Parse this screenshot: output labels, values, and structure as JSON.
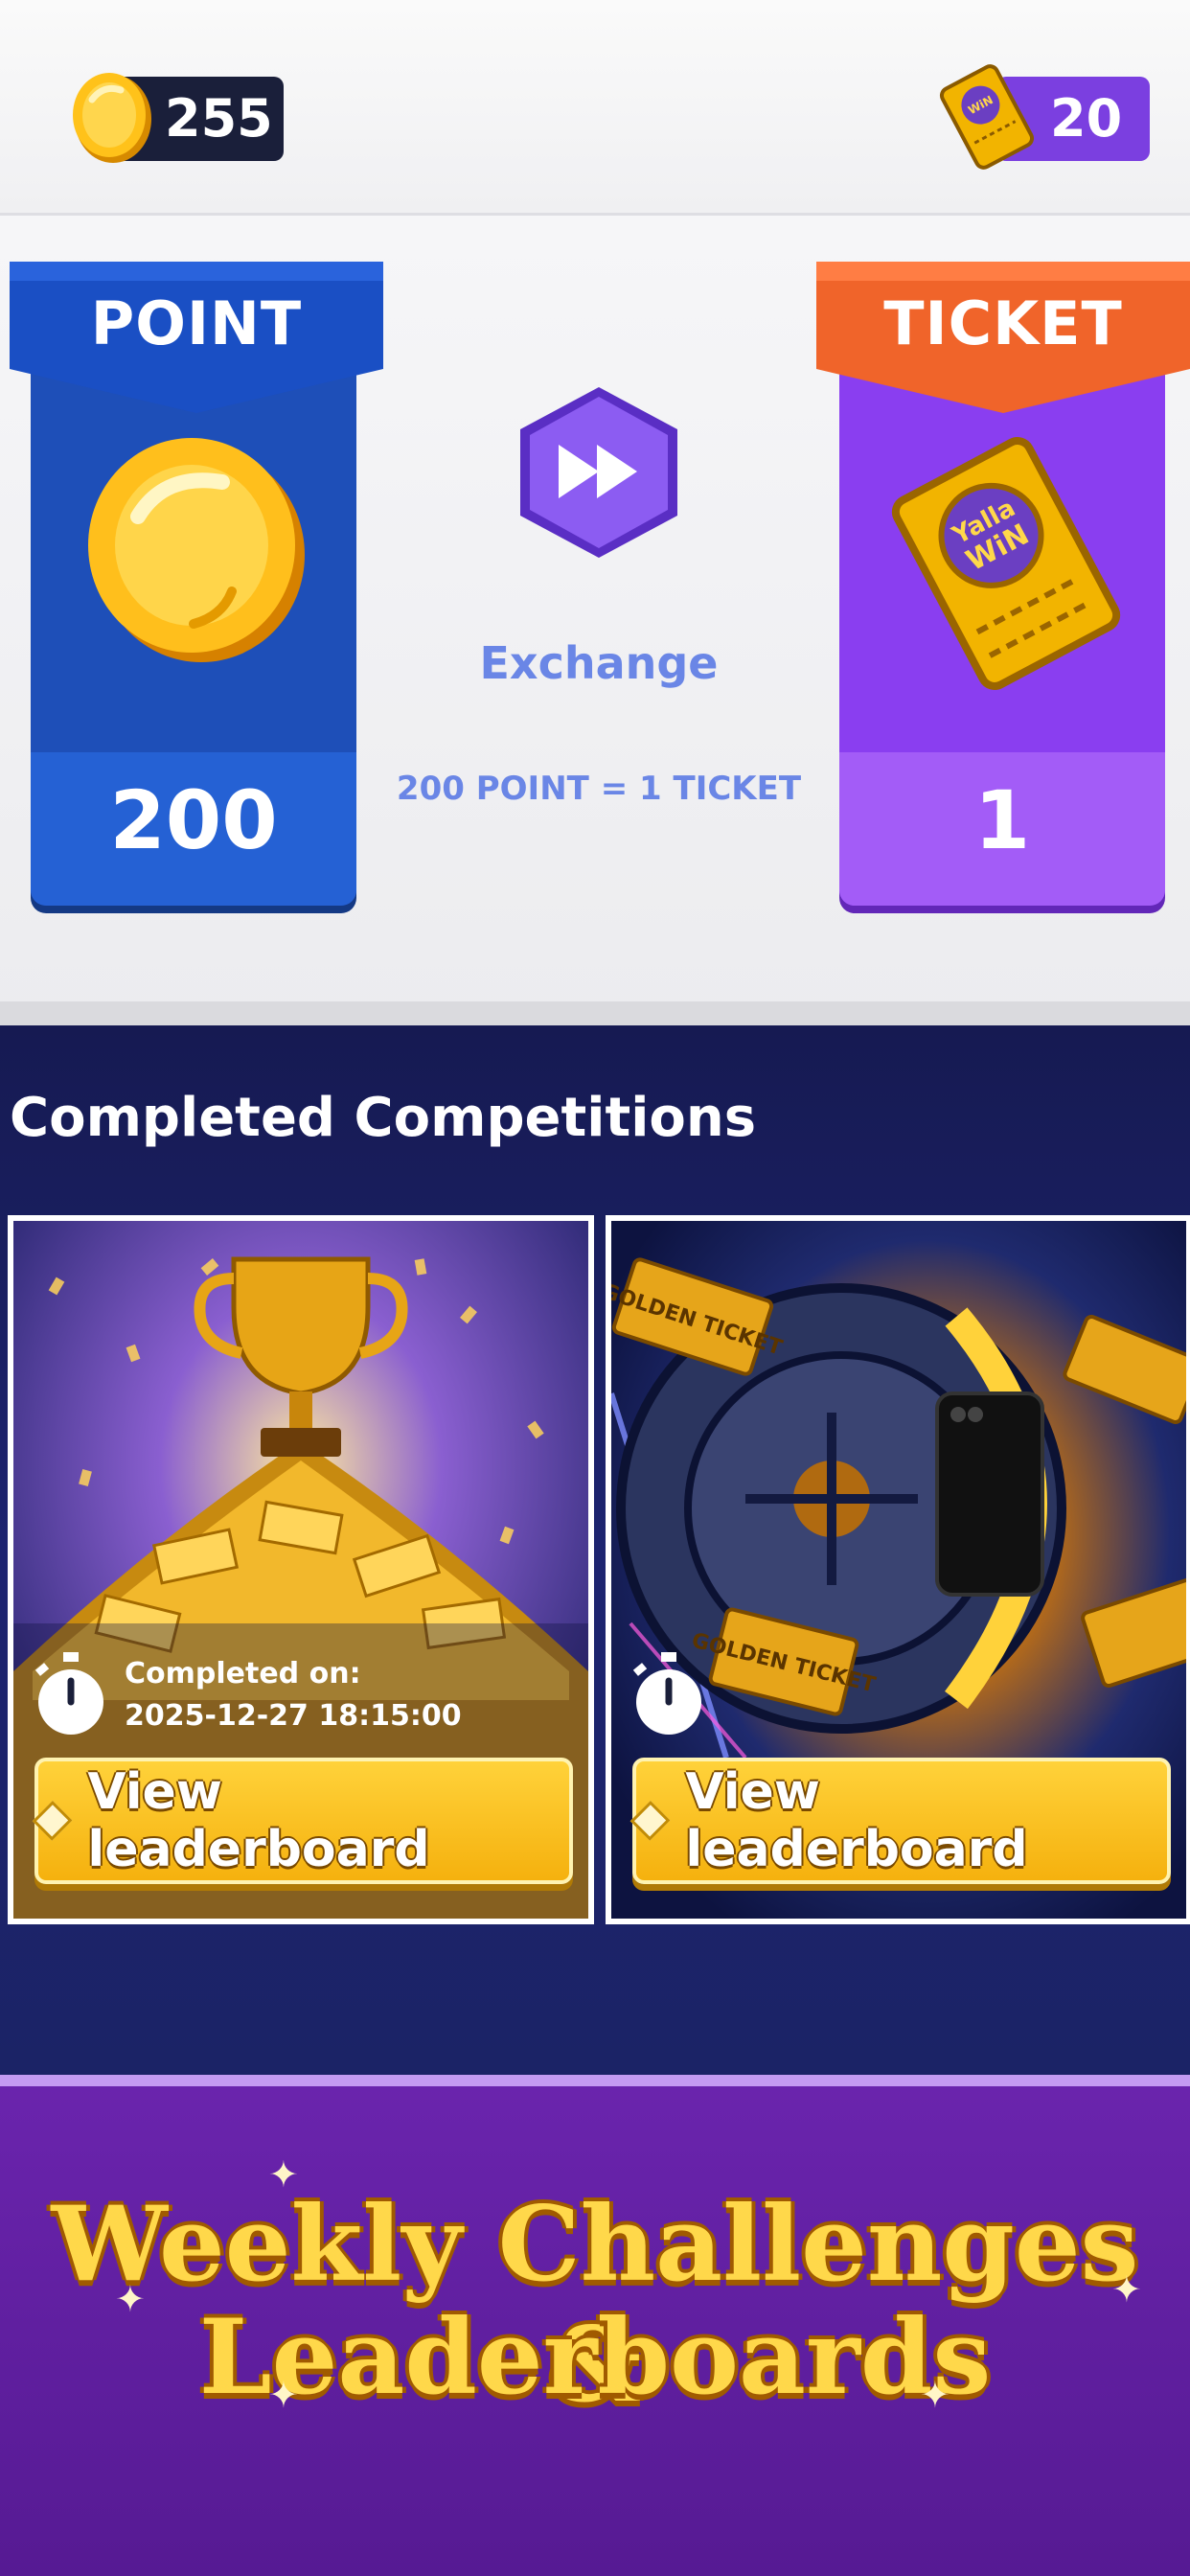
{
  "balance": {
    "points": "255",
    "tickets": "20"
  },
  "exchange": {
    "point_card": {
      "label": "POINT",
      "value": "200"
    },
    "ticket_card": {
      "label": "TICKET",
      "value": "1",
      "logo_text_top": "Yalla",
      "logo_text_bottom": "WiN"
    },
    "button_label": "Exchange",
    "rate_text": "200 POINT = 1 TICKET"
  },
  "competitions": {
    "title": "Completed Competitions",
    "cards": [
      {
        "completed_label": "Completed on:",
        "completed_date": "2025-12-27 18:15:00",
        "button_label": "View leaderboard"
      },
      {
        "art_text_1": "GOLDEN TICKET",
        "art_text_2": "GOLDEN TICKET",
        "button_label": "View leaderboard"
      }
    ]
  },
  "promo": {
    "line1": "Weekly Challenges &",
    "line2": "Leaderboards"
  },
  "colors": {
    "point_blue": "#1e4fb8",
    "ticket_purple": "#8a3ef0",
    "ticket_banner_orange": "#f0642a",
    "gold": "#ffd23a",
    "navy_bg": "#1b2366",
    "promo_purple": "#5f1f9f"
  },
  "icons": {
    "coin": "coin-icon",
    "ticket": "ticket-icon",
    "fast_forward": "fast-forward-icon",
    "stopwatch": "stopwatch-icon",
    "trophy": "trophy-icon",
    "vault": "vault-icon",
    "diamond": "diamond-icon"
  }
}
